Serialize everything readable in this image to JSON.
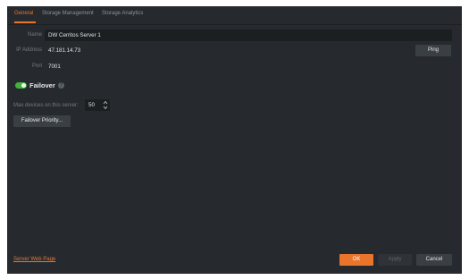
{
  "tabs": [
    {
      "label": "General"
    },
    {
      "label": "Storage Management"
    },
    {
      "label": "Storage Analytics"
    }
  ],
  "form": {
    "name": {
      "label": "Name",
      "value": "DW Cerritos Server 1"
    },
    "ip": {
      "label": "IP Address",
      "value": "47.181.14.73"
    },
    "port": {
      "label": "Port",
      "value": "7001"
    },
    "ping_label": "Ping"
  },
  "failover": {
    "label": "Failover",
    "enabled": true,
    "max_devices_label": "Max devices on this server:",
    "max_devices_value": "50",
    "priority_button": "Failover Priority..."
  },
  "footer": {
    "web_page_link": "Server Web Page",
    "ok": "OK",
    "apply": "Apply",
    "cancel": "Cancel"
  },
  "colors": {
    "accent": "#e9752d",
    "toggle_on": "#41b23a",
    "panel": "#262a2e",
    "field": "#1c1f22"
  }
}
